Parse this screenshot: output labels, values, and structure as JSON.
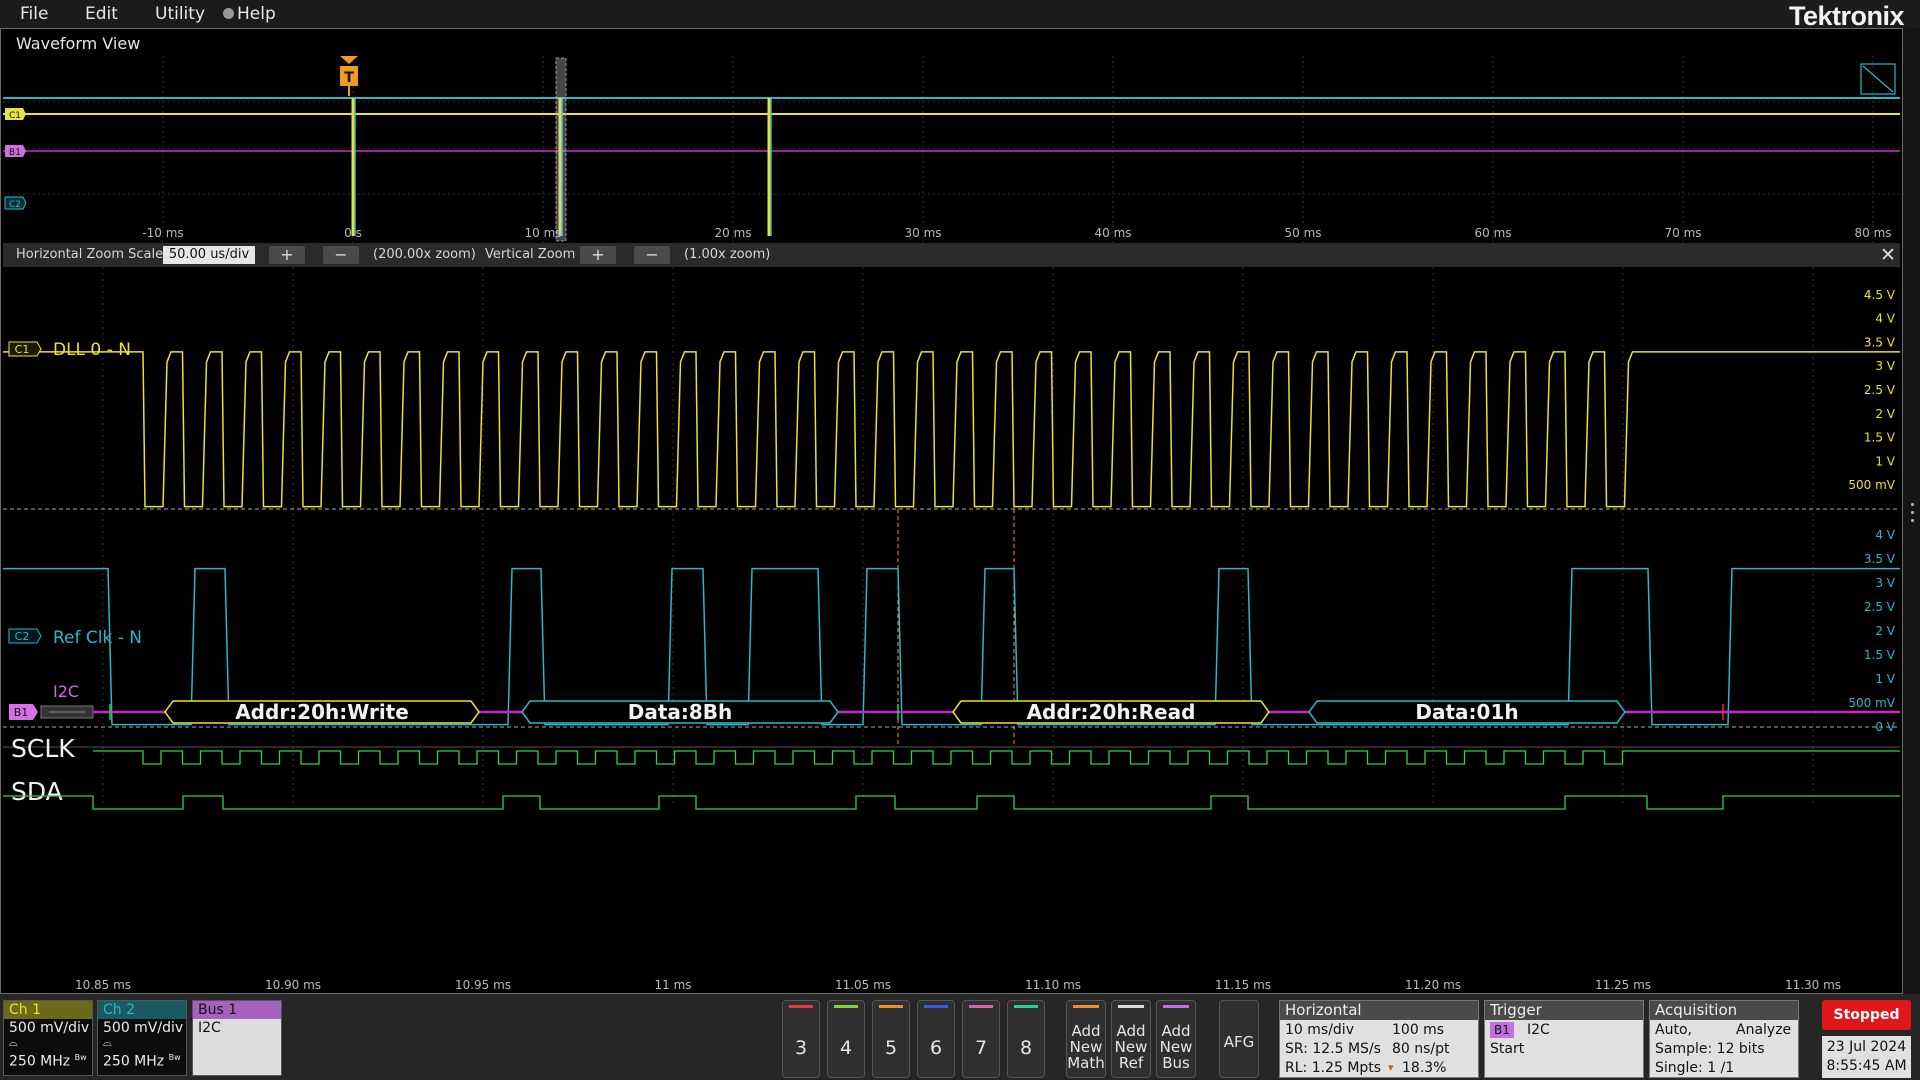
{
  "menu": {
    "file": "File",
    "edit": "Edit",
    "utility": "Utility",
    "help": "Help",
    "brand": "Tektronix"
  },
  "waveform_view": {
    "title": "Waveform View",
    "trigger_marker": "T",
    "overview_channel_markers": [
      "C1",
      "B1",
      "C2"
    ],
    "overview_time_labels": [
      "-10 ms",
      "0 s",
      "10 ms",
      "20 ms",
      "30 ms",
      "40 ms",
      "50 ms",
      "60 ms",
      "70 ms",
      "80 ms"
    ]
  },
  "zoom_bar": {
    "horizontal_label": "Horizontal Zoom Scale",
    "horizontal_value": "50.00 us/div",
    "horizontal_factor": "(200.00x zoom)",
    "vertical_label": "Vertical Zoom",
    "vertical_factor": "(1.00x zoom)",
    "plus": "+",
    "minus": "−",
    "close": "✕"
  },
  "channels": {
    "c1": {
      "badge": "C1",
      "label": "DLL 0 - N",
      "color": "#e8e336",
      "voltage_labels": [
        "4.5 V",
        "4 V",
        "3.5 V",
        "3 V",
        "2.5 V",
        "2 V",
        "1.5 V",
        "1 V",
        "500 mV"
      ],
      "clock_high_v": 3.3,
      "clock_low_v": 0.05,
      "clock_cycles": 38
    },
    "c2": {
      "badge": "C2",
      "label": "Ref Clk - N",
      "color": "#2ab7c7",
      "voltage_labels": [
        "4 V",
        "3.5 V",
        "3 V",
        "2.5 V",
        "2 V",
        "1.5 V",
        "1 V",
        "500 mV",
        "0 V"
      ],
      "high_v": 3.3,
      "low_v": 0.05
    },
    "bus": {
      "badge": "B1",
      "label": "I2C",
      "color": "#cc30cc",
      "packets": [
        "Addr:20h:Write",
        "Data:8Bh",
        "Addr:20h:Read",
        "Data:01h"
      ],
      "sclk_label": "SCLK",
      "sda_label": "SDA"
    }
  },
  "zoom_time_labels": [
    "10.85 ms",
    "10.90 ms",
    "10.95 ms",
    "11 ms",
    "11.05 ms",
    "11.10 ms",
    "11.15 ms",
    "11.20 ms",
    "11.25 ms",
    "11.30 ms"
  ],
  "bottom": {
    "ch1": {
      "title": "Ch 1",
      "scale": "500 mV/div",
      "bw": "250 MHz",
      "bw_sup": "Bw",
      "color": "#e8e336"
    },
    "ch2": {
      "title": "Ch 2",
      "scale": "500 mV/div",
      "bw": "250 MHz",
      "bw_sup": "Bw",
      "color": "#2ab7c7"
    },
    "bus1": {
      "title": "Bus 1",
      "type": "I2C",
      "color": "#c070e0"
    },
    "channel_buttons": [
      {
        "num": "3",
        "color": "#e03a3a"
      },
      {
        "num": "4",
        "color": "#7fd43a"
      },
      {
        "num": "5",
        "color": "#f0902a"
      },
      {
        "num": "6",
        "color": "#3a5ae0"
      },
      {
        "num": "7",
        "color": "#e060b0"
      },
      {
        "num": "8",
        "color": "#2ad090"
      }
    ],
    "add_math": {
      "label": "Add New Math",
      "color": "#f0902a"
    },
    "add_ref": {
      "label": "Add New Ref",
      "color": "#dddddd"
    },
    "add_bus": {
      "label": "Add New Bus",
      "color": "#c070e0"
    },
    "afg": "AFG",
    "horizontal": {
      "title": "Horizontal",
      "scale": "10 ms/div",
      "record_time": "100 ms",
      "sample_rate": "SR: 12.5 MS/s",
      "resolution": "80 ns/pt",
      "record_length": "RL: 1.25 Mpts",
      "position": "18.3%"
    },
    "trigger": {
      "title": "Trigger",
      "source": "B1",
      "type": "I2C",
      "condition": "Start"
    },
    "acquisition": {
      "title": "Acquisition",
      "mode": "Auto,",
      "analyze": "Analyze",
      "sample": "Sample: 12 bits",
      "single": "Single: 1 /1"
    },
    "status": "Stopped",
    "date": "23 Jul 2024",
    "time": "8:55:45 AM"
  }
}
